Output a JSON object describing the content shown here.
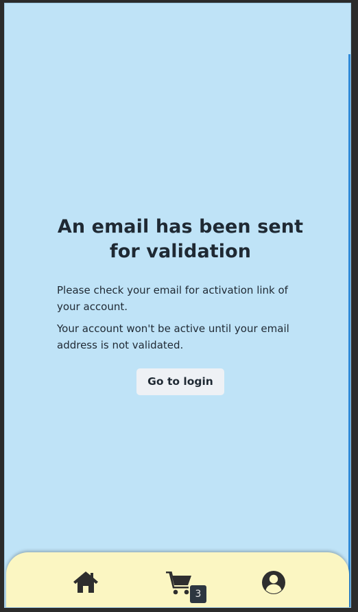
{
  "message": {
    "title": "An email has been sent for validation",
    "paragraphs": [
      "Please check your email for activation link of your account.",
      "Your account won't be active until your email address is not validated."
    ],
    "button_label": "Go to login"
  },
  "nav": {
    "items": [
      {
        "name": "home",
        "icon": "home-icon"
      },
      {
        "name": "cart",
        "icon": "cart-icon",
        "badge": "3"
      },
      {
        "name": "account",
        "icon": "user-circle-icon"
      }
    ]
  },
  "colors": {
    "background": "#bfe3f7",
    "nav_background": "#fbf6c2",
    "text": "#1f2933",
    "accent": "#2f8ad8",
    "badge": "#2d3640"
  }
}
